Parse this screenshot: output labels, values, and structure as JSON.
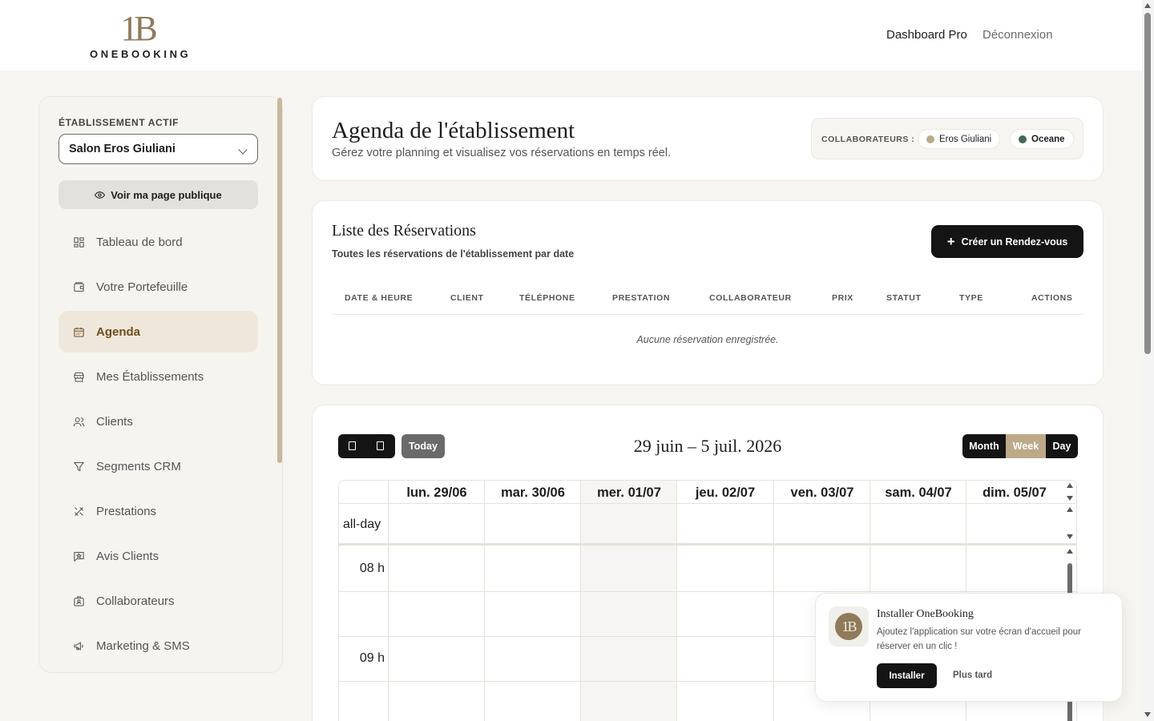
{
  "header": {
    "logo_mark": "1B",
    "logo_text": "ONEBOOKING",
    "nav": {
      "dashboard": "Dashboard Pro",
      "logout": "Déconnexion"
    }
  },
  "sidebar": {
    "section_label": "ÉTABLISSEMENT ACTIF",
    "selected_establishment": "Salon Eros Giuliani",
    "public_page_button": "Voir ma page publique",
    "items": [
      {
        "label": "Tableau de bord",
        "icon": "dashboard-icon",
        "active": false
      },
      {
        "label": "Votre Portefeuille",
        "icon": "wallet-icon",
        "active": false
      },
      {
        "label": "Agenda",
        "icon": "calendar-icon",
        "active": true
      },
      {
        "label": "Mes Établissements",
        "icon": "store-icon",
        "active": false
      },
      {
        "label": "Clients",
        "icon": "users-icon",
        "active": false
      },
      {
        "label": "Segments CRM",
        "icon": "filter-icon",
        "active": false
      },
      {
        "label": "Prestations",
        "icon": "tools-icon",
        "active": false
      },
      {
        "label": "Avis Clients",
        "icon": "review-star-icon",
        "active": false
      },
      {
        "label": "Collaborateurs",
        "icon": "id-badge-icon",
        "active": false
      },
      {
        "label": "Marketing & SMS",
        "icon": "megaphone-icon",
        "active": false
      }
    ]
  },
  "agenda": {
    "title": "Agenda de l'établissement",
    "subtitle": "Gérez votre planning et visualisez vos réservations en temps réel.",
    "collaborators_label": "COLLABORATEURS :",
    "collaborators": [
      {
        "name": "Eros Giuliani",
        "color": "#bba988"
      },
      {
        "name": "Oceane",
        "color": "#3f6b57"
      }
    ]
  },
  "reservations": {
    "title": "Liste des Réservations",
    "subtitle": "Toutes les réservations de l'établissement par date",
    "create_button": "Créer un Rendez-vous",
    "columns": [
      "DATE & HEURE",
      "CLIENT",
      "TÉLÉPHONE",
      "PRESTATION",
      "COLLABORATEUR",
      "PRIX",
      "STATUT",
      "TYPE",
      "ACTIONS"
    ],
    "empty_message": "Aucune réservation enregistrée."
  },
  "calendar": {
    "today_button": "Today",
    "range_title": "29 juin – 5 juil. 2026",
    "views": {
      "month": "Month",
      "week": "Week",
      "day": "Day"
    },
    "active_view": "Week",
    "days": [
      "lun. 29/06",
      "mar. 30/06",
      "mer. 01/07",
      "jeu. 02/07",
      "ven. 03/07",
      "sam. 04/07",
      "dim. 05/07"
    ],
    "today_day": "mer. 01/07",
    "allday_label": "all-day",
    "hours": [
      "08 h",
      "09 h"
    ]
  },
  "install_popup": {
    "title": "Installer OneBooking",
    "text": "Ajoutez l'application sur votre écran d'accueil pour réserver en un clic !",
    "install_button": "Installer",
    "later_button": "Plus tard"
  },
  "colors": {
    "accent": "#bba988",
    "brand": "#8f7a5a",
    "dark": "#141414",
    "active_menu_bg": "#f0e7dc"
  }
}
